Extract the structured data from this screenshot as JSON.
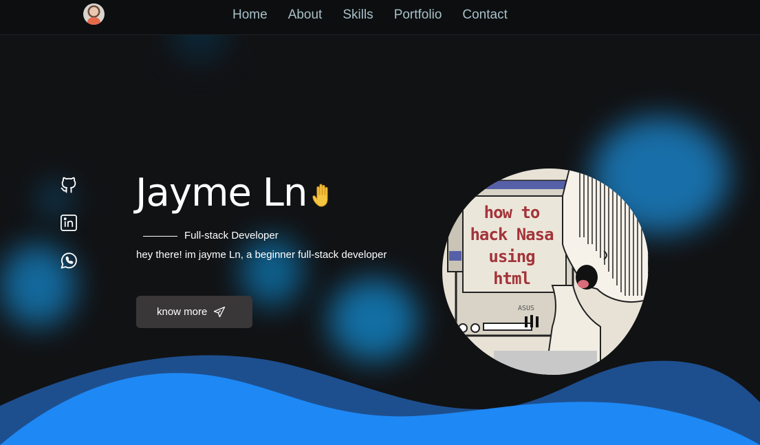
{
  "nav": {
    "links": [
      "Home",
      "About",
      "Skills",
      "Portfolio",
      "Contact"
    ]
  },
  "socials": [
    {
      "icon": "github-icon"
    },
    {
      "icon": "linkedin-icon"
    },
    {
      "icon": "whatsapp-icon"
    }
  ],
  "hero": {
    "name": "Jayme Ln",
    "emoji": "🖐",
    "role": "Full-stack Developer",
    "description": "hey there! im jayme Ln, a beginner full-stack developer",
    "cta_label": "know more"
  },
  "illustration": {
    "screen_lines": [
      "how to",
      "hack Nasa",
      "using",
      "html"
    ],
    "brand": "ASUS"
  },
  "colors": {
    "background": "#111214",
    "nav_text": "#a9c1c8",
    "wave_dark": "#1d4f8f",
    "wave_light": "#1e88f5",
    "button_bg": "#3a3738",
    "screen_text": "#a3343a"
  }
}
